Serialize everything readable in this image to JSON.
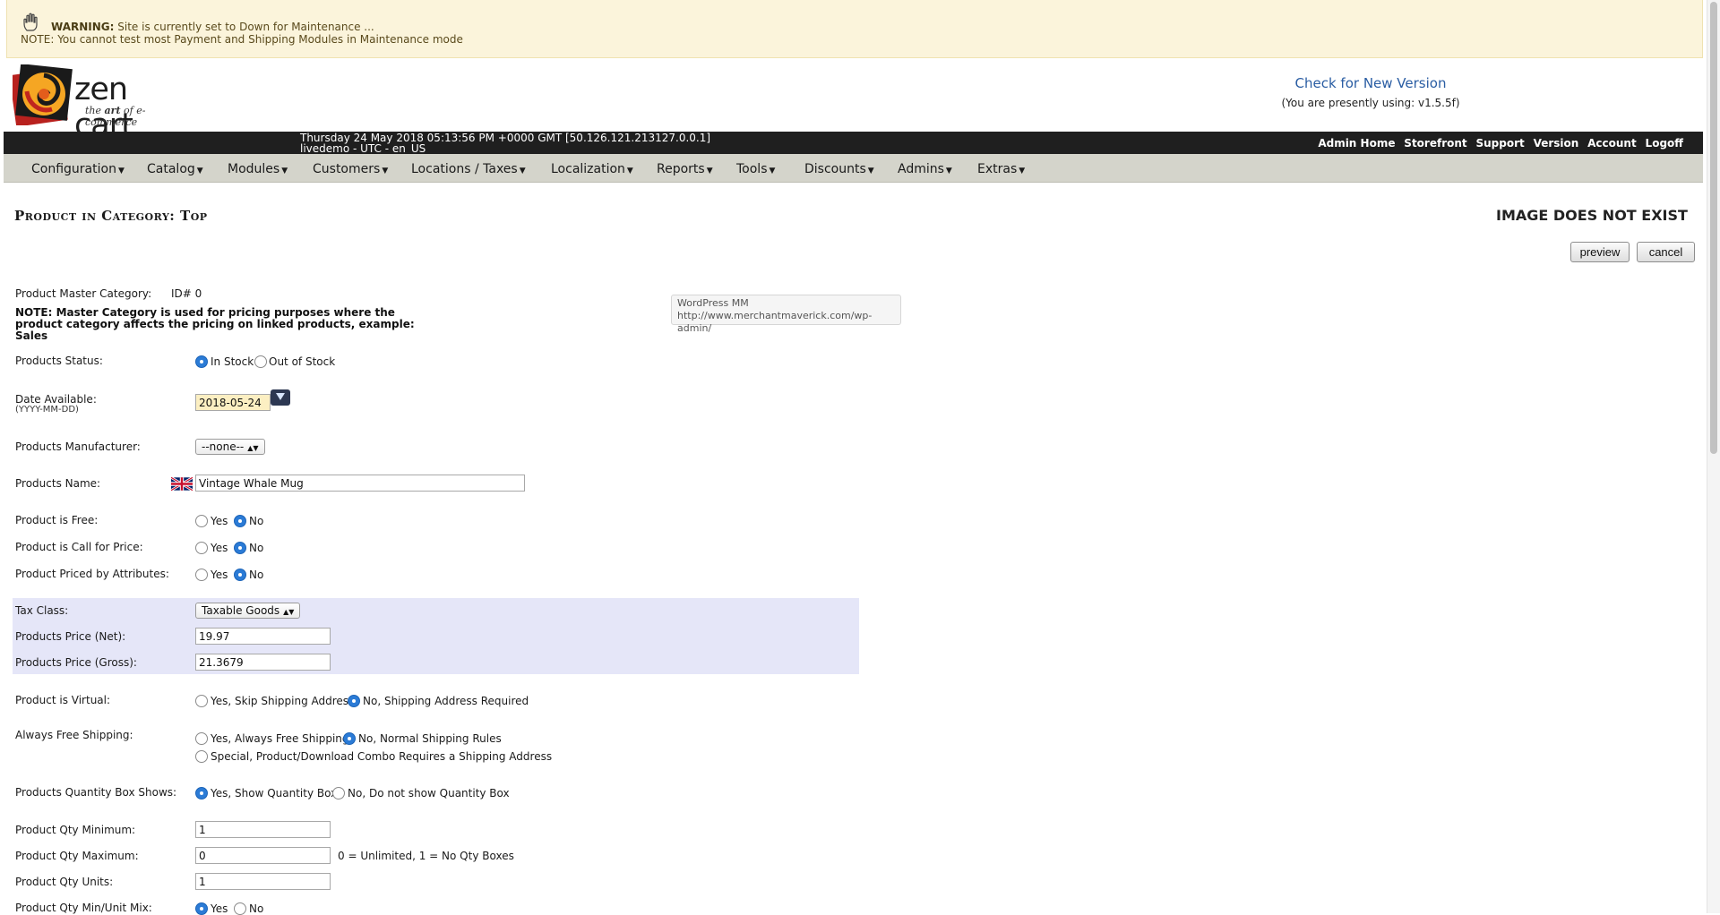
{
  "warning": {
    "title": "WARNING:",
    "message": "Site is currently set to Down for Maintenance ...",
    "note": "NOTE: You cannot test most Payment and Shipping Modules in Maintenance mode"
  },
  "logo": {
    "name": "zen cart",
    "tagline_pre": "the ",
    "tagline_art": "art",
    "tagline_post": " of e-commerce"
  },
  "version": {
    "link": "Check for New Version",
    "current": "(You are presently using: v1.5.5f)"
  },
  "topbar": {
    "datetime": "Thursday 24 May 2018 05:13:56 PM +0000 GMT [50.126.121.213127.0.0.1]",
    "site": "livedemo - UTC - en_US",
    "links": [
      "Admin Home",
      "Storefront",
      "Support",
      "Version",
      "Account",
      "Logoff"
    ]
  },
  "nav": [
    "Configuration",
    "Catalog",
    "Modules",
    "Customers",
    "Locations / Taxes",
    "Localization",
    "Reports",
    "Tools",
    "Discounts",
    "Admins",
    "Extras"
  ],
  "page": {
    "heading": "Product in Category: Top",
    "no_image": "IMAGE DOES NOT EXIST",
    "preview_label": "preview",
    "cancel_label": "cancel"
  },
  "tooltip": {
    "line1": "WordPress MM",
    "line2": "http://www.merchantmaverick.com/wp-admin/"
  },
  "form": {
    "master_category_label": "Product Master Category:",
    "master_category_value": "ID# 0",
    "master_note": "NOTE: Master Category is used for pricing purposes where the product category affects the pricing on linked products, example: Sales",
    "status_label": "Products Status:",
    "status_in": "In Stock",
    "status_out": "Out of Stock",
    "date_label": "Date Available:",
    "date_format": "(YYYY-MM-DD)",
    "date_value": "2018-05-24",
    "manufacturer_label": "Products Manufacturer:",
    "manufacturer_value": "--none--",
    "name_label": "Products Name:",
    "name_value": "Vintage Whale Mug",
    "free_label": "Product is Free:",
    "call_label": "Product is Call for Price:",
    "attr_label": "Product Priced by Attributes:",
    "yes": "Yes",
    "no": "No",
    "tax_label": "Tax Class:",
    "tax_value": "Taxable Goods",
    "net_label": "Products Price (Net):",
    "net_value": "19.97",
    "gross_label": "Products Price (Gross):",
    "gross_value": "21.3679",
    "virtual_label": "Product is Virtual:",
    "virtual_yes": "Yes, Skip Shipping Address",
    "virtual_no": "No, Shipping Address Required",
    "freeship_label": "Always Free Shipping:",
    "freeship_yes": "Yes, Always Free Shipping",
    "freeship_no": "No, Normal Shipping Rules",
    "freeship_special": "Special, Product/Download Combo Requires a Shipping Address",
    "qtybox_label": "Products Quantity Box Shows:",
    "qtybox_yes": "Yes, Show Quantity Box",
    "qtybox_no": "No, Do not show Quantity Box",
    "qty_min_label": "Product Qty Minimum:",
    "qty_min_value": "1",
    "qty_max_label": "Product Qty Maximum:",
    "qty_max_value": "0",
    "qty_max_hint": "0 = Unlimited, 1 = No Qty Boxes",
    "qty_units_label": "Product Qty Units:",
    "qty_units_value": "1",
    "qty_mix_label": "Product Qty Min/Unit Mix:"
  }
}
